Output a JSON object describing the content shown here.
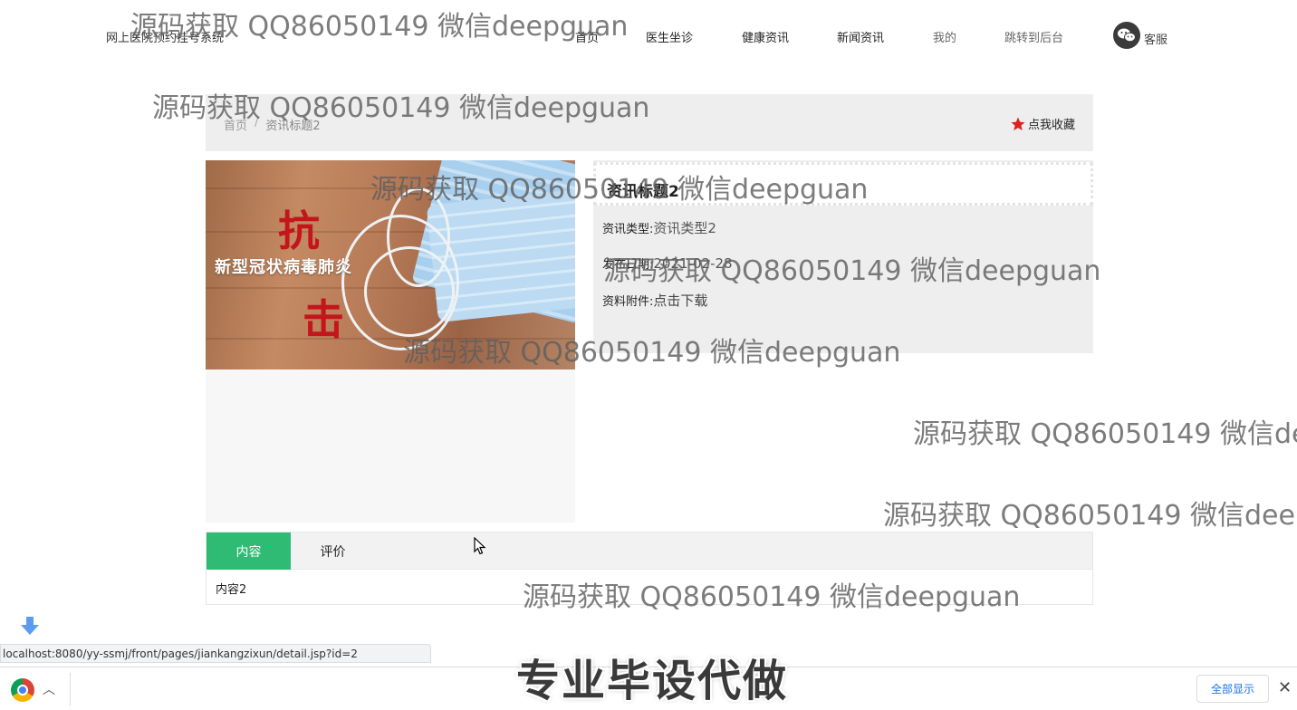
{
  "header": {
    "site_title": "网上医院预约挂号系统",
    "nav": [
      {
        "label": "首页"
      },
      {
        "label": "医生坐诊"
      },
      {
        "label": "健康资讯"
      },
      {
        "label": "新闻资讯"
      },
      {
        "label": "我的"
      },
      {
        "label": "跳转到后台"
      }
    ],
    "service_label": "客服"
  },
  "breadcrumb": {
    "home": "首页",
    "separator": "/",
    "current": "资讯标题2"
  },
  "favorite_label": "点我收藏",
  "image": {
    "big_char_1": "抗",
    "big_char_2": "击",
    "banner": "新型冠状病毒肺炎"
  },
  "detail": {
    "title": "资讯标题2",
    "type_label": "资讯类型:",
    "type_value": "资讯类型2",
    "date_label": "发布日期:",
    "date_value": "2021-02-28",
    "attachment_label": "资料附件:",
    "attachment_link": "点击下载"
  },
  "tabs": [
    {
      "label": "内容",
      "active": true
    },
    {
      "label": "评价",
      "active": false
    }
  ],
  "tab_content": "内容2",
  "watermark": "源码获取 QQ86050149 微信deepguan",
  "status_url": "localhost:8080/yy-ssmj/front/pages/jiankangzixun/detail.jsp?id=2",
  "overlay_text": "专业毕设代做",
  "shelf": {
    "show_all": "全部显示",
    "close": "✕"
  },
  "colors": {
    "tab_active": "#2fbb74",
    "star": "#e02020",
    "link_blue": "#1a73e8"
  }
}
